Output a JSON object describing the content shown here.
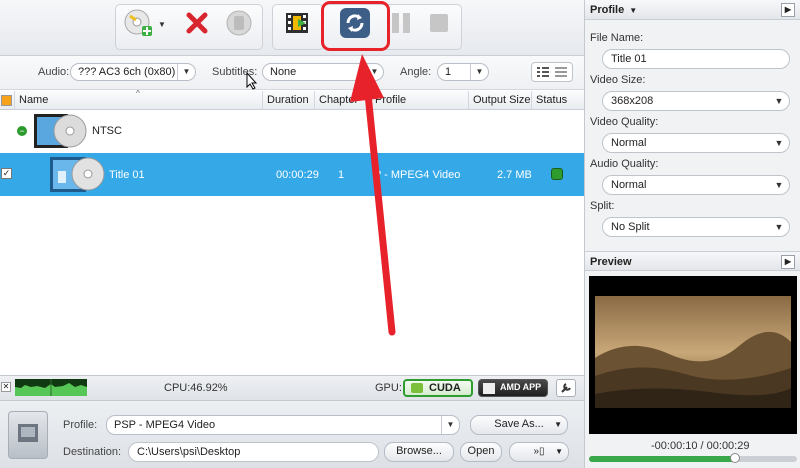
{
  "toolbar": {
    "buttons": [
      "add-file",
      "remove",
      "clear",
      "add-effect",
      "convert",
      "pause",
      "stop"
    ]
  },
  "options": {
    "audio_label": "Audio:",
    "audio_value": "??? AC3 6ch (0x80)",
    "subtitles_label": "Subtitles:",
    "subtitles_value": "None",
    "angle_label": "Angle:",
    "angle_value": "1"
  },
  "table": {
    "columns": [
      "Name",
      "Duration",
      "Chapter",
      "Profile",
      "Output Size",
      "Status"
    ],
    "group_name": "NTSC",
    "rows": [
      {
        "name": "Title 01",
        "duration": "00:00:29",
        "chapter": "1",
        "profile": "? - MPEG4 Video",
        "output_size": "2.7 MB"
      }
    ]
  },
  "statusbar": {
    "cpu": "CPU:46.92%",
    "gpu_label": "GPU:",
    "cuda": "CUDA",
    "amd": "AMD APP"
  },
  "bottom": {
    "profile_label": "Profile:",
    "profile_value": "PSP - MPEG4 Video",
    "saveas": "Save As...",
    "destination_label": "Destination:",
    "destination_value": "C:\\Users\\psi\\Desktop",
    "browse": "Browse...",
    "open": "Open"
  },
  "profile_panel": {
    "title": "Profile",
    "file_name_label": "File Name:",
    "file_name_value": "Title 01",
    "video_size_label": "Video Size:",
    "video_size_value": "368x208",
    "video_quality_label": "Video Quality:",
    "video_quality_value": "Normal",
    "audio_quality_label": "Audio Quality:",
    "audio_quality_value": "Normal",
    "split_label": "Split:",
    "split_value": "No Split"
  },
  "preview": {
    "title": "Preview",
    "time": "-00:00:10 / 00:00:29",
    "progress": 0.7
  },
  "colors": {
    "selection": "#35a8e8",
    "highlight_annotation": "#e8222a",
    "cuda_green": "#2e9d2e"
  }
}
